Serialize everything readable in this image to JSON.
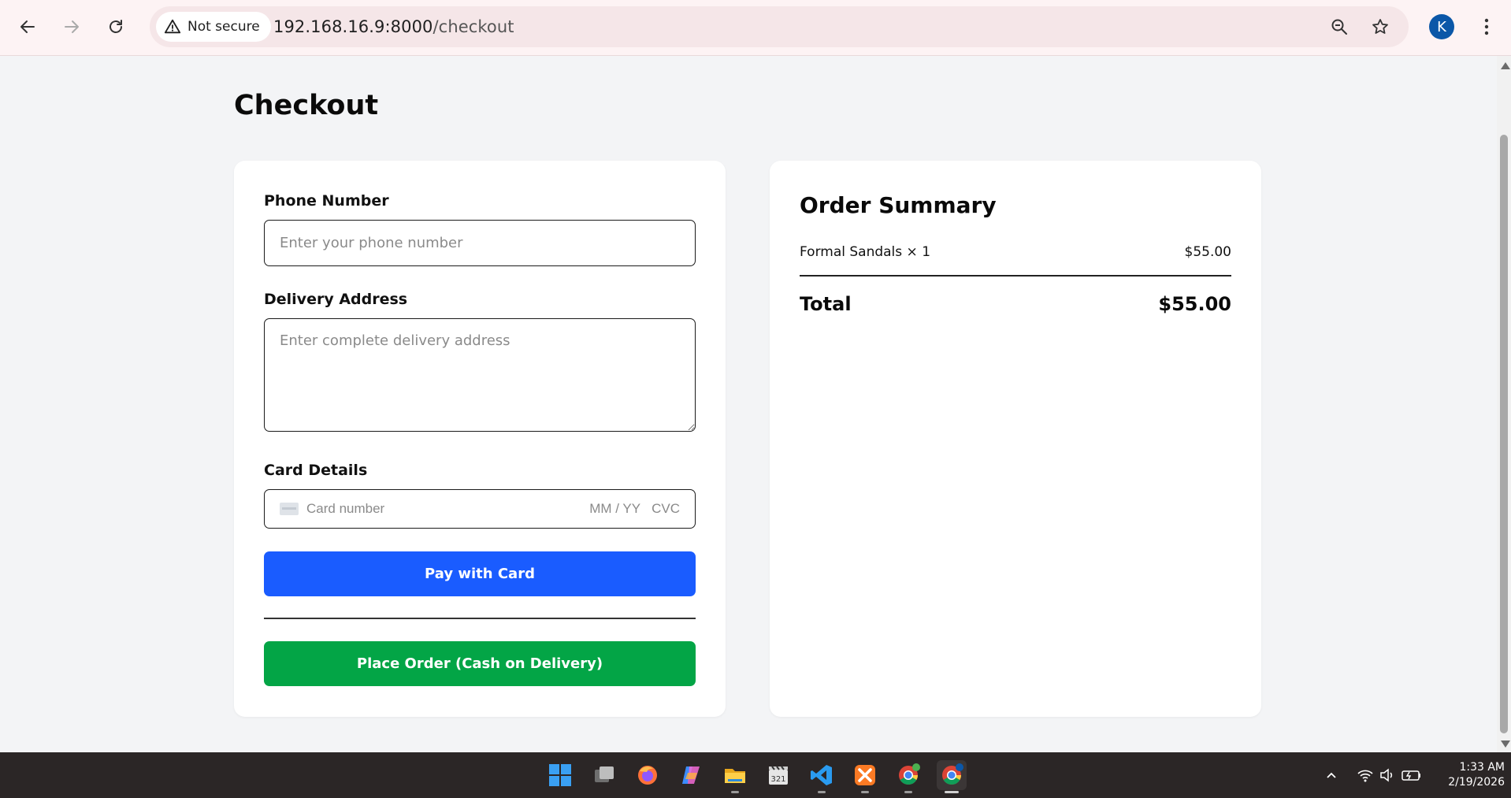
{
  "browser": {
    "security_label": "Not secure",
    "url_host": "192.168.16.9:8000",
    "url_path": "/checkout",
    "profile_initial": "K"
  },
  "page": {
    "title": "Checkout"
  },
  "form": {
    "phone_label": "Phone Number",
    "phone_placeholder": "Enter your phone number",
    "address_label": "Delivery Address",
    "address_placeholder": "Enter complete delivery address",
    "card_label": "Card Details",
    "card_number_placeholder": "Card number",
    "card_expiry_placeholder": "MM / YY",
    "card_cvc_placeholder": "CVC",
    "pay_button": "Pay with Card",
    "cod_button": "Place Order (Cash on Delivery)"
  },
  "summary": {
    "title": "Order Summary",
    "items": [
      {
        "name": "Formal Sandals × 1",
        "price": "$55.00"
      }
    ],
    "total_label": "Total",
    "total_value": "$55.00"
  },
  "taskbar": {
    "time": "1:33 AM",
    "date": "2/19/2026",
    "apps": [
      "start-icon",
      "task-view-icon",
      "firefox-icon",
      "copilot-icon",
      "file-explorer-icon",
      "video-editor-icon",
      "vscode-icon",
      "xampp-icon",
      "chrome-icon",
      "chrome-profile-icon"
    ]
  },
  "colors": {
    "pay_button": "#1a5cff",
    "cod_button": "#03a546",
    "page_background": "#f3f4f6",
    "avatar": "#0b57a8"
  }
}
